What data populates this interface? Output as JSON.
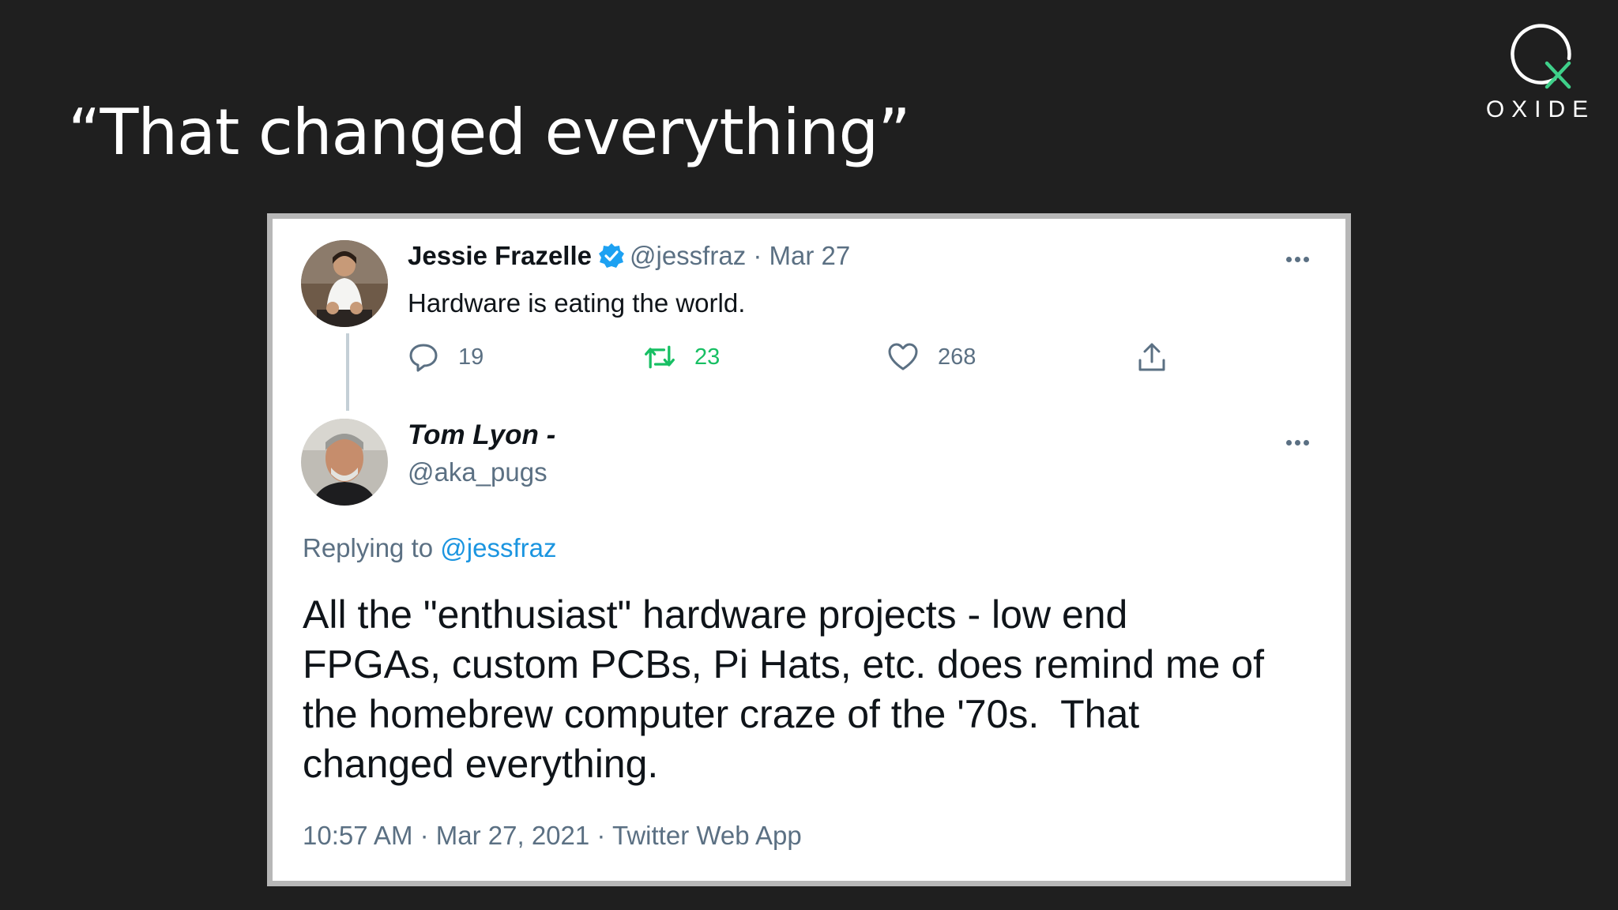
{
  "slide": {
    "title": "“That changed everything”",
    "logo_text": "OXIDE"
  },
  "colors": {
    "background": "#1f1f1f",
    "tweet_background": "#ffffff",
    "frame": "#b7b7b7",
    "muted": "#5b7083",
    "link": "#1b95e0",
    "retweet": "#17bf63",
    "verified": "#1da1f2",
    "logo_accent": "#3fd08a"
  },
  "tweet1": {
    "display_name": "Jessie Frazelle",
    "handle": "@jessfraz",
    "separator": "·",
    "date": "Mar 27",
    "text": "Hardware is eating the world.",
    "avatar_icon": "avatar-photo-jessie",
    "replies": "19",
    "retweets": "23",
    "likes": "268",
    "icons": [
      "reply-icon",
      "retweet-icon",
      "like-icon",
      "share-icon",
      "more-icon",
      "verified-badge-icon"
    ]
  },
  "tweet2": {
    "display_name": "Tom Lyon -",
    "handle": "@aka_pugs",
    "avatar_icon": "avatar-photo-tom",
    "replying_prefix": "Replying to",
    "replying_to": "@jessfraz",
    "lines": [
      "All the \"enthusiast\" hardware projects - low end",
      "FPGAs, custom PCBs, Pi Hats, etc. does remind me of",
      "the homebrew computer craze of the '70s.  That",
      "changed everything."
    ],
    "time": "10:57 AM",
    "date": "Mar 27, 2021",
    "source": "Twitter Web App",
    "meta_separator": "·"
  }
}
